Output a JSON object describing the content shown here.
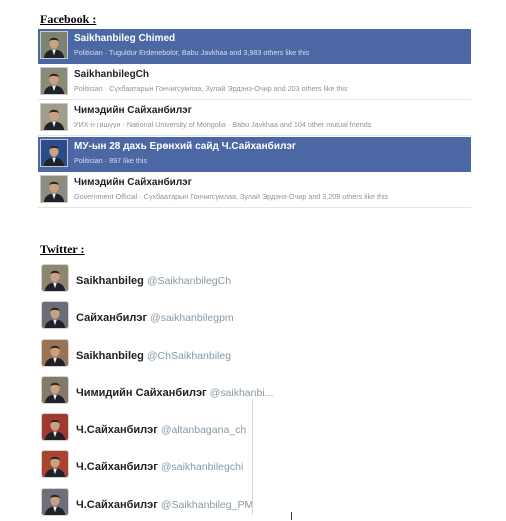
{
  "facebook": {
    "title": "Facebook :",
    "results": [
      {
        "name": "Saikhanbileg Chimed",
        "subtitle": "Politician · Tuguldur Erdenebolor, Babu Javkhaa and 3,983 others like this",
        "selected": true,
        "avatar_bg": "#7a8470"
      },
      {
        "name": "SaikhanbilegCh",
        "subtitle": "Politician · Сүхбаатарын Гончигсумлаа, Зулай Эрдэнэ-Очир and 203 others like this",
        "selected": false,
        "avatar_bg": "#8b8a76"
      },
      {
        "name": "Чимэдийн Сайханбилэг",
        "subtitle": "УИХ-н гишүүн · National University of Mongolia · Babu Javkhaa and 104 other mutual friends",
        "selected": false,
        "avatar_bg": "#a29c8c"
      },
      {
        "name": "МУ-ын 28 дахь Ерөнхий сайд Ч.Сайханбилэг",
        "subtitle": "Politician · 897 like this",
        "selected": true,
        "avatar_bg": "#2c4b8a"
      },
      {
        "name": "Чимэдийн Сайханбилэг",
        "subtitle": "Government Official · Сүхбаатарын Гончигсумлаа, Зулай Эрдэнэ-Очир and 3,209 others like this",
        "selected": false,
        "avatar_bg": "#8f8c80"
      }
    ]
  },
  "twitter": {
    "title": "Twitter :",
    "results": [
      {
        "name": "Saikhanbileg",
        "handle": "@SaikhanbilegCh",
        "avatar_bg": "#8f8672"
      },
      {
        "name": "Сайханбилэг",
        "handle": "@saikhanbilegpm",
        "avatar_bg": "#6b6e78"
      },
      {
        "name": "Saikhanbileg",
        "handle": "@ChSaikhanbileg",
        "avatar_bg": "#9a7254"
      },
      {
        "name": "Чимидийн Сайханбилэг",
        "handle": "@saikhanbi...",
        "avatar_bg": "#857a6a"
      },
      {
        "name": "Ч.Сайханбилэг",
        "handle": "@altanbagana_ch",
        "avatar_bg": "#9e3a2e"
      },
      {
        "name": "Ч.Сайханбилэг",
        "handle": "@saikhanbilegchi",
        "avatar_bg": "#a8442f"
      },
      {
        "name": "Ч.Сайханбилэг",
        "handle": "@Saikhanbileg_PM",
        "avatar_bg": "#6d6f7a"
      }
    ]
  },
  "colors": {
    "facebook_selected": "#4b68a4",
    "twitter_handle": "#8899a6"
  }
}
